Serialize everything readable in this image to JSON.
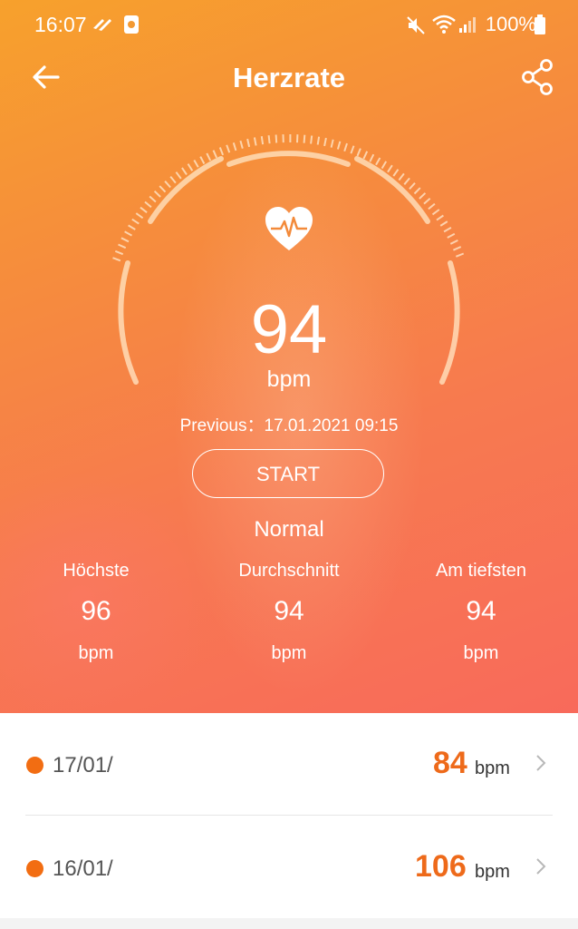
{
  "status_bar": {
    "time": "16:07",
    "battery": "100%"
  },
  "header": {
    "title": "Herzrate"
  },
  "measurement": {
    "value": "94",
    "unit": "bpm",
    "previous": "Previous：17.01.2021 09:15",
    "start_label": "START",
    "status": "Normal"
  },
  "stats": [
    {
      "label": "Höchste",
      "value": "96",
      "unit": "bpm"
    },
    {
      "label": "Durchschnitt",
      "value": "94",
      "unit": "bpm"
    },
    {
      "label": "Am tiefsten",
      "value": "94",
      "unit": "bpm"
    }
  ],
  "history": [
    {
      "date": "17/01/",
      "value": "84",
      "unit": "bpm"
    },
    {
      "date": "16/01/",
      "value": "106",
      "unit": "bpm"
    }
  ],
  "colors": {
    "accent": "#ee6a1a",
    "dot": "#f26d12",
    "hero_top": "#f7a12c",
    "hero_bottom": "#f86a5b"
  },
  "icons": [
    "back-arrow-icon",
    "share-icon",
    "heart-pulse-icon",
    "chevron-right-icon",
    "mute-icon",
    "wifi-icon",
    "signal-icon",
    "battery-icon"
  ]
}
